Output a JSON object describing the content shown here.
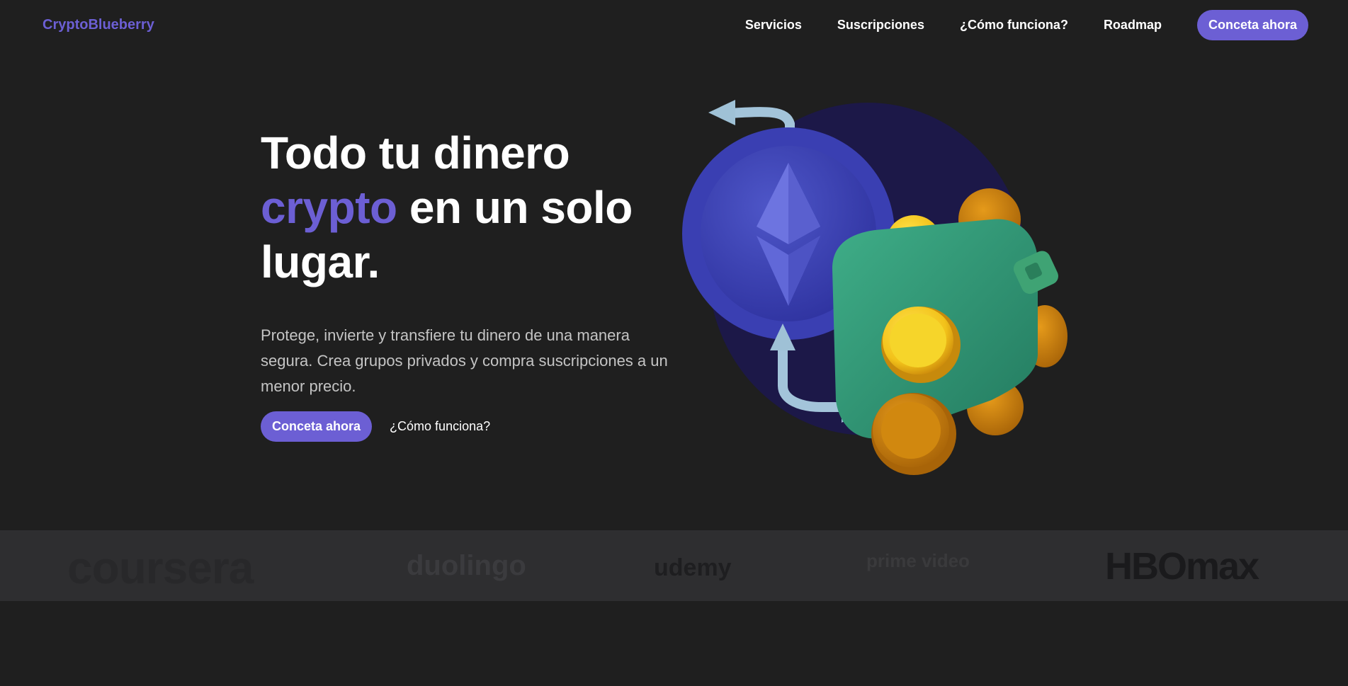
{
  "brand": {
    "name": "CryptoBlueberry"
  },
  "nav": {
    "links": [
      "Servicios",
      "Suscripciones",
      "¿Cómo funciona?",
      "Roadmap"
    ],
    "cta": "Conceta ahora"
  },
  "hero": {
    "headline_part1": "Todo tu dinero",
    "headline_accent": "crypto",
    "headline_part2": " en un solo lugar.",
    "subtext": "Protege, invierte y transfiere tu dinero de una manera segura. Crea grupos privados y compra suscripciones a un menor precio.",
    "cta": "Conceta ahora",
    "secondary_link": "¿Cómo funciona?"
  },
  "partners": {
    "logos": [
      "coursera",
      "duolingo",
      "udemy",
      "prime video",
      "HBOmax"
    ]
  },
  "colors": {
    "accent": "#6c5fd4",
    "background": "#1f1f1f",
    "band": "#2e2e30"
  },
  "icons": {
    "illustration": "ethereum-wallet-illustration"
  }
}
